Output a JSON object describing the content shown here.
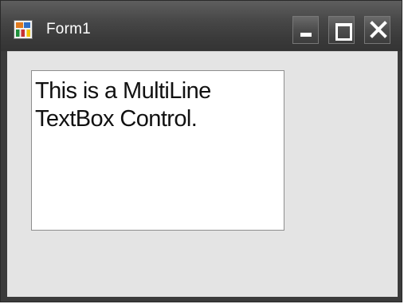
{
  "window": {
    "title": "Form1",
    "controls": {
      "minimize_icon": "minimize-icon",
      "maximize_icon": "maximize-icon",
      "close_icon": "close-icon"
    },
    "app_icon": "form-app-icon"
  },
  "textbox": {
    "value": "This is a MultiLine\nTextBox Control."
  },
  "colors": {
    "titlebar": "#474747",
    "client_background": "#e4e4e4",
    "textbox_background": "#ffffff",
    "title_text": "#ffffff"
  }
}
